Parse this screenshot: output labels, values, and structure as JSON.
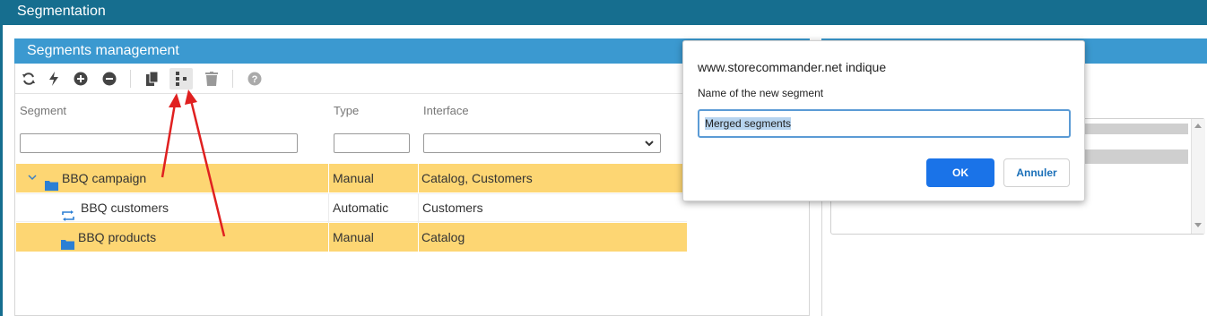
{
  "app": {
    "title": "Segmentation"
  },
  "panel": {
    "title": "Segments management"
  },
  "toolbar": {
    "icons": [
      "refresh-icon",
      "bolt-icon",
      "add-circle-icon",
      "remove-circle-icon",
      "copy-icon",
      "merge-icon",
      "trash-icon",
      "help-icon"
    ]
  },
  "grid": {
    "columns": [
      "Segment",
      "Type",
      "Interface"
    ],
    "rows": [
      {
        "segment": "BBQ campaign",
        "type": "Manual",
        "interface": "Catalog, Customers",
        "selected": true,
        "icon": "folder-icon"
      },
      {
        "segment": "BBQ customers",
        "type": "Automatic",
        "interface": "Customers",
        "selected": false,
        "icon": "sync-icon"
      },
      {
        "segment": "BBQ products",
        "type": "Manual",
        "interface": "Catalog",
        "selected": true,
        "icon": "folder-icon"
      }
    ]
  },
  "dialog": {
    "title": "www.storecommander.net indique",
    "message": "Name of the new segment",
    "input_value": "Merged segments",
    "ok_label": "OK",
    "cancel_label": "Annuler"
  },
  "colors": {
    "titlebar": "#166e8f",
    "panel_header": "#3b99d0",
    "selected_row": "#fdd673",
    "ok_button": "#1a73e8",
    "annotation_arrow": "#e02020"
  }
}
